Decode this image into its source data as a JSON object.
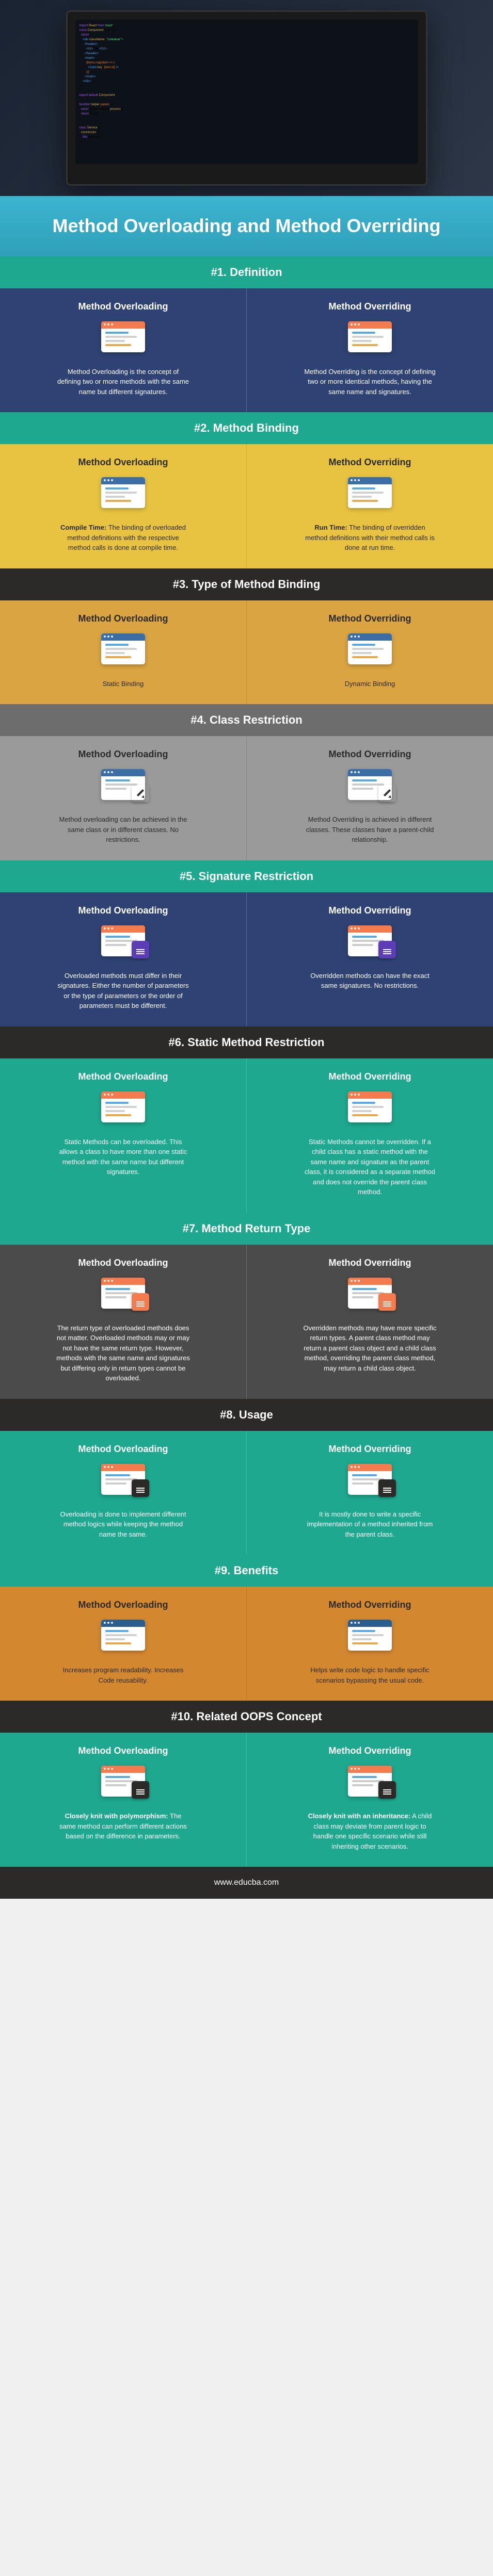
{
  "title": "Method Overloading and Method Overriding",
  "footer": "www.educba.com",
  "leftHead": "Method Overloading",
  "rightHead": "Method Overriding",
  "sections": [
    {
      "heading": "#1. Definition",
      "headClass": "h-teal",
      "rowClass": "bg-blue",
      "iconStyle": "window-flat",
      "barColor": "#f47b4e",
      "left": "Method Overloading is the concept of defining two or more methods with the same name but different signatures.",
      "right": "Method Overriding is the concept of defining two or more identical methods, having the same name and signatures."
    },
    {
      "heading": "#2. Method Binding",
      "headClass": "h-teal",
      "rowClass": "bg-yellow",
      "iconStyle": "window-flat",
      "barColor": "#3a6ea5",
      "leftBold": "Compile Time:",
      "left": " The binding of overloaded method definitions with the respective method calls is done at compile time.",
      "rightBold": "Run Time:",
      "right": " The binding of overridden method definitions with their method calls is done at run time."
    },
    {
      "heading": "#3. Type of Method Binding",
      "headClass": "h-dark",
      "rowClass": "bg-orange",
      "iconStyle": "window-flat",
      "barColor": "#3a6ea5",
      "left": "Static Binding",
      "right": "Dynamic Binding"
    },
    {
      "heading": "#4. Class Restriction",
      "headClass": "h-gray",
      "rowClass": "bg-gray",
      "iconStyle": "window-pencil",
      "barColor": "#3a6ea5",
      "left": "Method overloading can be achieved in the same class or in different classes. No restrictions.",
      "right": "Method Overriding is achieved in different classes. These classes have a parent-child relationship."
    },
    {
      "heading": "#5. Signature Restriction",
      "headClass": "h-teal",
      "rowClass": "bg-blue",
      "iconStyle": "window-badge",
      "barColor": "#f47b4e",
      "badgeColor": "#5c3db5",
      "left": "Overloaded methods must differ in their signatures. Either the number of parameters or the type of parameters or the order of parameters must be different.",
      "right": "Overridden methods can have the exact same signatures. No restrictions."
    },
    {
      "heading": "#6. Static Method Restriction",
      "headClass": "h-dark",
      "rowClass": "bg-teal",
      "iconStyle": "window-flat",
      "barColor": "#f47b4e",
      "left": "Static Methods can be overloaded. This allows a class to have more than one static method with the same name but different signatures.",
      "right": "Static Methods cannot be overridden. If a child class has a static method with the same name and signature as the parent class, it is considered as a separate method and does not override the parent class method."
    },
    {
      "heading": "#7. Method Return Type",
      "headClass": "h-teal",
      "rowClass": "bg-darkgray",
      "iconStyle": "window-badge",
      "barColor": "#f47b4e",
      "badgeColor": "#f47b4e",
      "left": "The return type of overloaded methods does not matter. Overloaded methods may or may not have the same return type. However, methods with the same name and signatures but differing only in return types cannot be overloaded.",
      "right": "Overridden methods may have more specific return types. A parent class method may return a parent class object and a child class method, overriding the parent class method, may return a child class object."
    },
    {
      "heading": "#8. Usage",
      "headClass": "h-dark",
      "rowClass": "bg-teal",
      "iconStyle": "window-badge",
      "barColor": "#f47b4e",
      "badgeColor": "#2b2a29",
      "left": "Overloading is done to implement different method logics while keeping the method name the same.",
      "right": "It is mostly done to write a specific implementation of a method inherited from the parent class."
    },
    {
      "heading": "#9. Benefits",
      "headClass": "h-teal",
      "rowClass": "bg-orange2",
      "iconStyle": "window-flat",
      "barColor": "#2b5e8c",
      "left": "Increases program readability. Increases Code reusability.",
      "right": "Helps write code logic to handle specific scenarios bypassing the usual code."
    },
    {
      "heading": "#10. Related OOPS Concept",
      "headClass": "h-dark",
      "rowClass": "bg-teal",
      "iconStyle": "window-badge",
      "barColor": "#f47b4e",
      "badgeColor": "#2b2a29",
      "leftBold": "Closely knit with polymorphism:",
      "left": " The same method can perform different actions based on the difference in parameters.",
      "rightBold": "Closely knit with an inheritance:",
      "right": " A child class may deviate from parent logic to handle one specific scenario while still inheriting other scenarios."
    }
  ]
}
